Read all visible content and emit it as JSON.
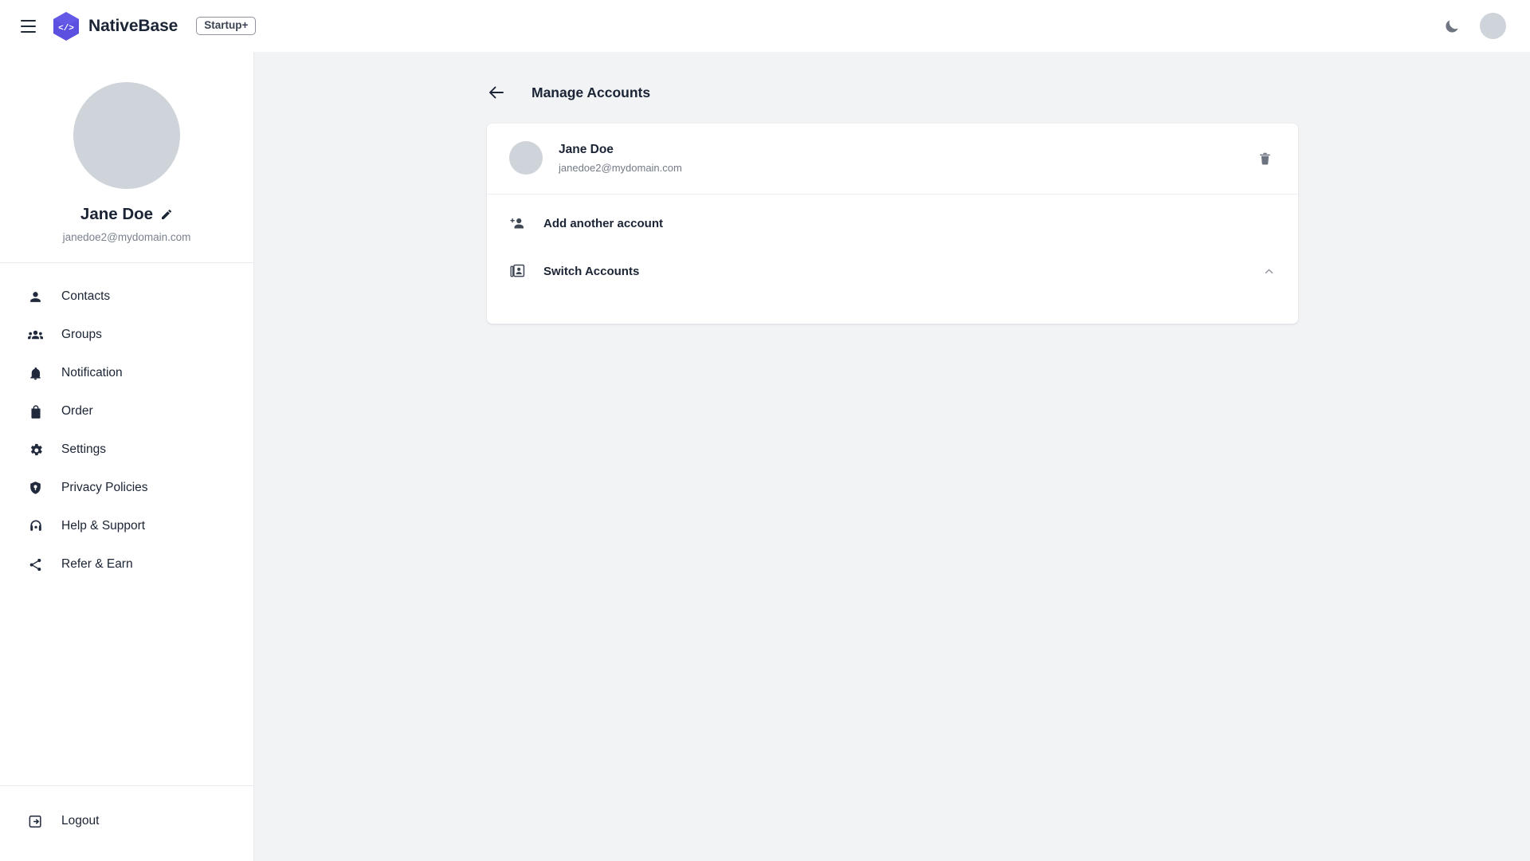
{
  "navbar": {
    "menu_icon": "hamburger-menu-icon",
    "brand": "NativeBase",
    "plan_badge": "Startup+",
    "theme_toggle_icon": "moon-icon",
    "avatar_icon": "user-avatar"
  },
  "sidebar": {
    "profile": {
      "name": "Jane Doe",
      "email": "janedoe2@mydomain.com",
      "edit_icon": "pencil-icon",
      "avatar_icon": "profile-photo"
    },
    "items": [
      {
        "label": "Contacts",
        "icon": "person-icon"
      },
      {
        "label": "Groups",
        "icon": "group-people-icon"
      },
      {
        "label": "Notification",
        "icon": "bell-icon"
      },
      {
        "label": "Order",
        "icon": "shopping-bag-icon"
      },
      {
        "label": "Settings",
        "icon": "gear-icon"
      },
      {
        "label": "Privacy Policies",
        "icon": "shield-icon"
      },
      {
        "label": "Help & Support",
        "icon": "headset-icon"
      },
      {
        "label": "Refer & Earn",
        "icon": "share-icon"
      }
    ],
    "footer": {
      "label": "Logout",
      "icon": "logout-icon"
    }
  },
  "main": {
    "back_icon": "arrow-left-icon",
    "title": "Manage Accounts",
    "account": {
      "name": "Jane Doe",
      "email": "janedoe2@mydomain.com",
      "avatar_icon": "account-photo",
      "delete_icon": "trash-icon"
    },
    "actions": [
      {
        "label": "Add another account",
        "icon": "person-add-icon",
        "trailing_icon": ""
      },
      {
        "label": "Switch Accounts",
        "icon": "switch-account-icon",
        "trailing_icon": "chevron-up-icon"
      }
    ]
  },
  "colors": {
    "brand_purple": "#5b50e0",
    "text_primary": "#1b2434",
    "text_muted": "#7a818d",
    "content_bg": "#f1f3f5",
    "card_bg": "#ffffff",
    "border": "#e7e9ec",
    "icon": "#5e6676"
  }
}
